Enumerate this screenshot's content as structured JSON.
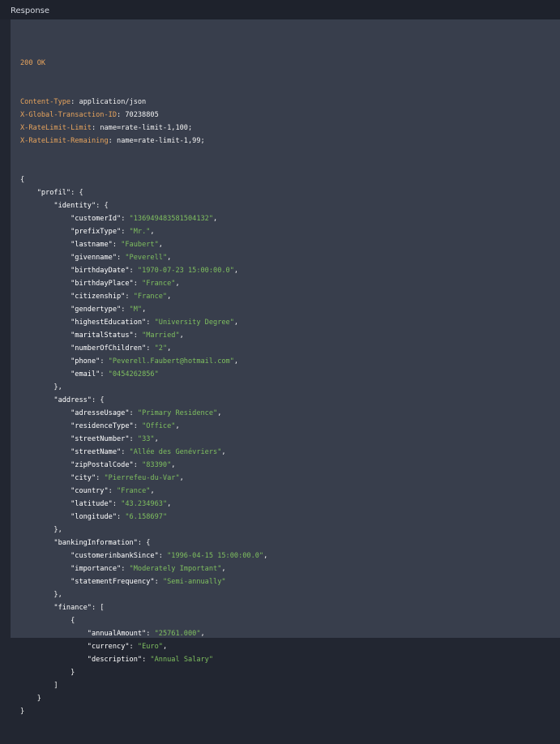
{
  "header": {
    "title": "Response"
  },
  "response": {
    "status": "200 OK",
    "headers": [
      {
        "name": "Content-Type",
        "value": "application/json"
      },
      {
        "name": "X-Global-Transaction-ID",
        "value": "70238805"
      },
      {
        "name": "X-RateLimit-Limit",
        "value": "name=rate-limit-1,100;"
      },
      {
        "name": "X-RateLimit-Remaining",
        "value": "name=rate-limit-1,99;"
      }
    ],
    "body_lines": [
      {
        "indent": 0,
        "t": "{"
      },
      {
        "indent": 1,
        "key": "profil",
        "t": ": {"
      },
      {
        "indent": 2,
        "key": "identity",
        "t": ": {"
      },
      {
        "indent": 3,
        "key": "customerId",
        "val": "136949483581504132",
        "end": ","
      },
      {
        "indent": 3,
        "key": "prefixType",
        "val": "Mr.",
        "end": ","
      },
      {
        "indent": 3,
        "key": "lastname",
        "val": "Faubert",
        "end": ","
      },
      {
        "indent": 3,
        "key": "givenname",
        "val": "Peverell",
        "end": ","
      },
      {
        "indent": 3,
        "key": "birthdayDate",
        "val": "1970-07-23 15:00:00.0",
        "end": ","
      },
      {
        "indent": 3,
        "key": "birthdayPlace",
        "val": "France",
        "end": ","
      },
      {
        "indent": 3,
        "key": "citizenship",
        "val": "France",
        "end": ","
      },
      {
        "indent": 3,
        "key": "gendertype",
        "val": "M",
        "end": ","
      },
      {
        "indent": 3,
        "key": "highestEducation",
        "val": "University Degree",
        "end": ","
      },
      {
        "indent": 3,
        "key": "maritalStatus",
        "val": "Married",
        "end": ","
      },
      {
        "indent": 3,
        "key": "numberOfChildren",
        "val": "2",
        "end": ","
      },
      {
        "indent": 3,
        "key": "phone",
        "val": "Peverell.Faubert@hotmail.com",
        "end": ","
      },
      {
        "indent": 3,
        "key": "email",
        "val": "0454262856",
        "end": ""
      },
      {
        "indent": 2,
        "t": "},"
      },
      {
        "indent": 2,
        "key": "address",
        "t": ": {"
      },
      {
        "indent": 3,
        "key": "adresseUsage",
        "val": "Primary Residence",
        "end": ","
      },
      {
        "indent": 3,
        "key": "residenceType",
        "val": "Office",
        "end": ","
      },
      {
        "indent": 3,
        "key": "streetNumber",
        "val": "33",
        "end": ","
      },
      {
        "indent": 3,
        "key": "streetName",
        "val": "Allée des Genévriers",
        "end": ","
      },
      {
        "indent": 3,
        "key": "zipPostalCode",
        "val": "83390",
        "end": ","
      },
      {
        "indent": 3,
        "key": "city",
        "val": "Pierrefeu-du-Var",
        "end": ","
      },
      {
        "indent": 3,
        "key": "country",
        "val": "France",
        "end": ","
      },
      {
        "indent": 3,
        "key": "latitude",
        "val": "43.234963",
        "end": ","
      },
      {
        "indent": 3,
        "key": "longitude",
        "val": "6.158697",
        "end": ""
      },
      {
        "indent": 2,
        "t": "},"
      },
      {
        "indent": 2,
        "key": "bankingInformation",
        "t": ": {"
      },
      {
        "indent": 3,
        "key": "customerinbankSince",
        "val": "1996-04-15 15:00:00.0",
        "end": ","
      },
      {
        "indent": 3,
        "key": "importance",
        "val": "Moderately Important",
        "end": ","
      },
      {
        "indent": 3,
        "key": "statementFrequency",
        "val": "Semi-annually",
        "end": ""
      },
      {
        "indent": 2,
        "t": "},"
      },
      {
        "indent": 2,
        "key": "finance",
        "t": ": ["
      },
      {
        "indent": 3,
        "t": "{"
      },
      {
        "indent": 4,
        "key": "annualAmount",
        "val": "25761.000",
        "end": ","
      },
      {
        "indent": 4,
        "key": "currency",
        "val": "Euro",
        "end": ","
      },
      {
        "indent": 4,
        "key": "description",
        "val": "Annual Salary",
        "end": ""
      },
      {
        "indent": 3,
        "t": "}"
      },
      {
        "indent": 2,
        "t": "]"
      },
      {
        "indent": 1,
        "t": "}"
      },
      {
        "indent": 0,
        "t": "}"
      }
    ]
  },
  "colors": {
    "header_key": "#e7a45d",
    "string_value": "#7fbf5f",
    "panel_bg": "#383e4c",
    "page_bg": "#222631"
  }
}
